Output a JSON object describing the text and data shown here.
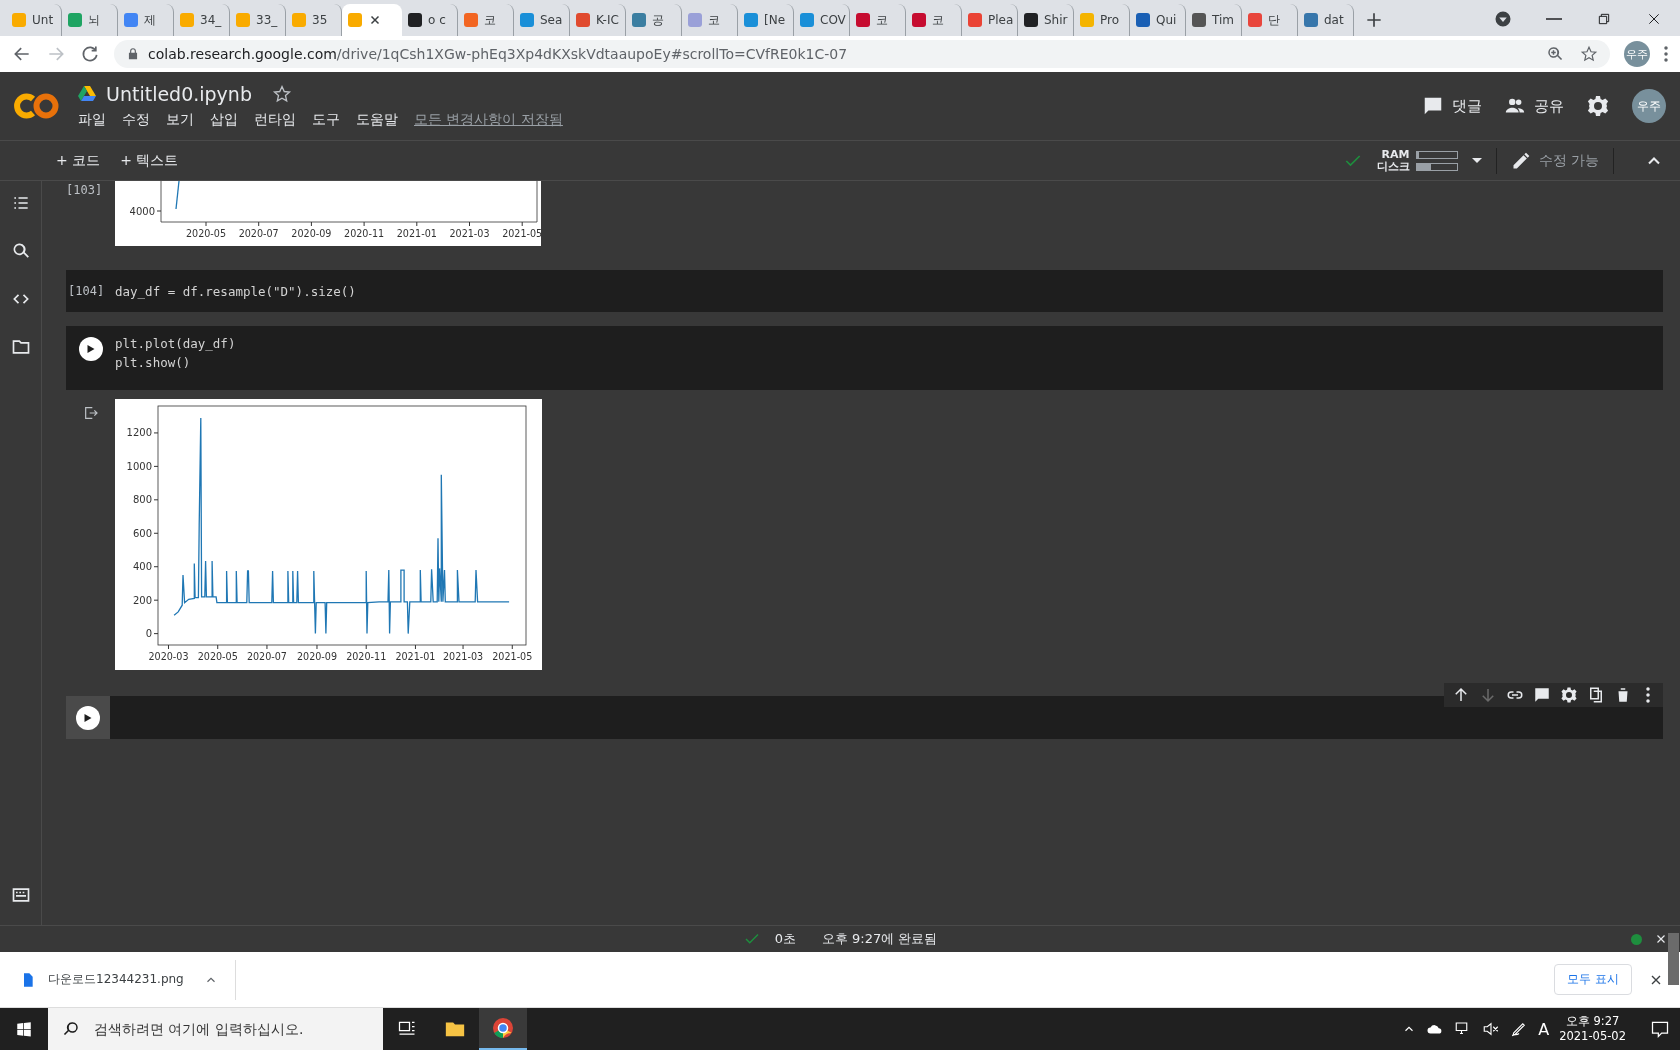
{
  "browser": {
    "tabs": [
      {
        "label": "Unt",
        "color": "#f9ab00",
        "selected": false
      },
      {
        "label": "뇌",
        "color": "#1fa463",
        "selected": false
      },
      {
        "label": "제",
        "color": "#4285f4",
        "selected": false
      },
      {
        "label": "34_",
        "color": "#f9ab00",
        "selected": false
      },
      {
        "label": "33_",
        "color": "#f9ab00",
        "selected": false
      },
      {
        "label": "35",
        "color": "#f9ab00",
        "selected": false
      },
      {
        "color": "#f9ab00",
        "selected": true
      },
      {
        "label": "o c",
        "color": "#202124",
        "selected": false
      },
      {
        "label": "코",
        "color": "#f26522",
        "selected": false
      },
      {
        "label": "Sea",
        "color": "#1a8fd8",
        "selected": false
      },
      {
        "label": "K-IC",
        "color": "#e04a2f",
        "selected": false
      },
      {
        "label": "공",
        "color": "#3b7ea1",
        "selected": false
      },
      {
        "label": "코",
        "color": "#9aa0d8",
        "selected": false
      },
      {
        "label": "[Ne",
        "color": "#1a8fd8",
        "selected": false
      },
      {
        "label": "COV",
        "color": "#1a8fd8",
        "selected": false
      },
      {
        "label": "코",
        "color": "#c60c30",
        "selected": false
      },
      {
        "label": "코",
        "color": "#c60c30",
        "selected": false
      },
      {
        "label": "Plea",
        "color": "#ea4335",
        "selected": false
      },
      {
        "label": "Shir",
        "color": "#202124",
        "selected": false
      },
      {
        "label": "Pro",
        "color": "#f4b400",
        "selected": false
      },
      {
        "label": "Qui",
        "color": "#1a5fb4",
        "selected": false
      },
      {
        "label": "Tim",
        "color": "#555555",
        "selected": false
      },
      {
        "label": "단",
        "color": "#e8453c",
        "selected": false
      },
      {
        "label": "dat",
        "color": "#3776ab",
        "selected": false
      }
    ],
    "url_host": "colab.research.google.com",
    "url_path": "/drive/1qCsh1XGw-phEq3Xp4dKXskVdtaaupoEy#scrollTo=CVfRE0k1C-07",
    "profile": "우주"
  },
  "notebook": {
    "title": "Untitled0.ipynb",
    "menu": [
      "파일",
      "수정",
      "보기",
      "삽입",
      "런타임",
      "도구",
      "도움말"
    ],
    "save_status": "모든 변경사항이 저장됨",
    "comment": "댓글",
    "share": "공유",
    "avatar": "우주"
  },
  "toolbar": {
    "add_code": "+ 코드",
    "add_text": "+ 텍스트",
    "ram_label": "RAM",
    "disk_label": "디스크",
    "ram": {
      "level": 0.05
    },
    "disk": {
      "level": 0.35
    },
    "edit_mode": "수정 가능"
  },
  "cells": [
    {
      "kind": "output",
      "prompt": "[103]",
      "ytick_labels": [
        "4000"
      ],
      "xtick_labels": [
        "2020-05",
        "2020-07",
        "2020-09",
        "2020-11",
        "2021-01",
        "2021-03",
        "2021-05"
      ]
    },
    {
      "kind": "code",
      "prompt": "[104]",
      "lines": [
        "day_df = df.resample(\"D\").size()"
      ]
    },
    {
      "kind": "code_run",
      "lines": [
        "plt.plot(day_df)",
        "plt.show()"
      ],
      "chart_data": {
        "type": "line",
        "xlim": [
          "2020-02-17",
          "2021-05-18"
        ],
        "ylim": [
          -68,
          1361
        ],
        "xticks": [
          {
            "value": "2020-03-01",
            "label": "2020-03"
          },
          {
            "value": "2020-05-01",
            "label": "2020-05"
          },
          {
            "value": "2020-07-01",
            "label": "2020-07"
          },
          {
            "value": "2020-09-01",
            "label": "2020-09"
          },
          {
            "value": "2020-11-01",
            "label": "2020-11"
          },
          {
            "value": "2021-01-01",
            "label": "2021-01"
          },
          {
            "value": "2021-03-01",
            "label": "2021-03"
          },
          {
            "value": "2021-05-01",
            "label": "2021-05"
          }
        ],
        "yticks": [
          0,
          200,
          400,
          600,
          800,
          1000,
          1200
        ],
        "x": [
          "2020-03-08",
          "2020-03-13",
          "2020-03-18",
          "2020-03-19",
          "2020-03-21",
          "2020-03-26",
          "2020-04-02",
          "2020-04-02",
          "2020-04-03",
          "2020-04-07",
          "2020-04-08",
          "2020-04-10",
          "2020-04-11",
          "2020-04-15",
          "2020-04-16",
          "2020-04-17",
          "2020-04-24",
          "2020-04-24",
          "2020-04-25",
          "2020-04-29",
          "2020-04-30",
          "2020-05-12",
          "2020-05-12",
          "2020-05-13",
          "2020-05-24",
          "2020-05-24",
          "2020-05-25",
          "2020-06-06",
          "2020-06-07",
          "2020-06-08",
          "2020-06-09",
          "2020-07-07",
          "2020-07-08",
          "2020-07-09",
          "2020-07-27",
          "2020-07-27",
          "2020-07-28",
          "2020-08-02",
          "2020-08-02",
          "2020-08-03",
          "2020-08-07",
          "2020-08-08",
          "2020-08-09",
          "2020-08-28",
          "2020-08-28",
          "2020-08-30",
          "2020-08-31",
          "2020-09-11",
          "2020-09-12",
          "2020-09-13",
          "2020-11-01",
          "2020-11-01",
          "2020-11-02",
          "2020-11-03",
          "2020-11-17",
          "2020-11-28",
          "2020-11-29",
          "2020-11-30",
          "2020-12-01",
          "2020-12-14",
          "2020-12-14",
          "2020-12-18",
          "2020-12-18",
          "2020-12-22",
          "2020-12-23",
          "2020-12-25",
          "2021-01-07",
          "2021-01-07",
          "2021-01-08",
          "2021-01-20",
          "2021-01-21",
          "2021-01-23",
          "2021-01-28",
          "2021-01-29",
          "2021-01-30",
          "2021-01-31",
          "2021-02-02",
          "2021-02-02",
          "2021-02-04",
          "2021-02-06",
          "2021-02-07",
          "2021-02-22",
          "2021-02-22",
          "2021-02-24",
          "2021-03-16",
          "2021-03-17",
          "2021-03-19",
          "2021-04-27"
        ],
        "series": [
          {
            "color": "#1f77b4",
            "values": [
              110,
              130,
              170,
              350,
              185,
              205,
              210,
              420,
              215,
              215,
              650,
              1290,
              220,
              220,
              435,
              220,
              220,
              435,
              220,
              220,
              185,
              185,
              375,
              185,
              185,
              375,
              185,
              185,
              375,
              375,
              185,
              185,
              375,
              185,
              185,
              375,
              185,
              185,
              375,
              185,
              185,
              375,
              185,
              185,
              375,
              0,
              185,
              185,
              0,
              185,
              185,
              375,
              0,
              185,
              190,
              190,
              380,
              0,
              190,
              190,
              380,
              380,
              190,
              190,
              0,
              190,
              190,
              380,
              190,
              190,
              385,
              190,
              190,
              570,
              190,
              390,
              190,
              950,
              190,
              380,
              190,
              190,
              380,
              190,
              190,
              380,
              190,
              190
            ]
          }
        ]
      }
    },
    {
      "kind": "empty"
    }
  ],
  "status": {
    "elapsed": "0초",
    "completed": "오후 9:27에 완료됨"
  },
  "download": {
    "file": "다운로드12344231.png",
    "show_all": "모두 표시"
  },
  "taskbar": {
    "search_placeholder": "검색하려면 여기에 입력하십시오.",
    "ime": "A",
    "time": "오후 9:27",
    "date": "2021-05-02"
  }
}
